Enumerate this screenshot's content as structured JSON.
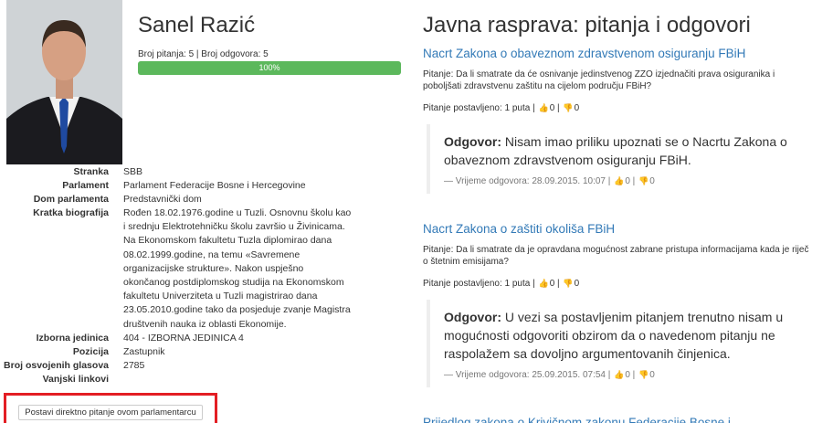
{
  "profile": {
    "name": "Sanel Razić",
    "counts": "Broj pitanja: 5 | Broj odgovora: 5",
    "progress_label": "100%",
    "progress_fraction": 1.0,
    "info": [
      {
        "label": "Stranka",
        "value": "SBB"
      },
      {
        "label": "Parlament",
        "value": "Parlament Federacije Bosne i Hercegovine"
      },
      {
        "label": "Dom parlamenta",
        "value": "Predstavnički dom"
      },
      {
        "label": "Kratka biografija",
        "value": "Rođen 18.02.1976.godine u Tuzli. Osnovnu školu kao i srednju Elektrotehničku školu završio u Živinicama. Na Ekonomskom fakultetu Tuzla diplomirao dana 08.02.1999.godine, na temu «Savremene organizacijske strukture». Nakon uspješno okončanog postdiplomskog studija na Ekonomskom fakultetu Univerziteta u Tuzli magistrirao dana 23.05.2010.godine tako da posjeduje zvanje Magistra društvenih nauka iz oblasti Ekonomije."
      },
      {
        "label": "Izborna jedinica",
        "value": "404 - IZBORNA JEDINICA 4"
      },
      {
        "label": "Pozicija",
        "value": "Zastupnik"
      },
      {
        "label": "Broj osvojenih glasova",
        "value": "2785"
      },
      {
        "label": "Vanjski linkovi",
        "value": ""
      }
    ],
    "direct_question_button": "Postavi direktno pitanje ovom parlamentarcu"
  },
  "discussion": {
    "title": "Javna rasprava: pitanja i odgovori",
    "questions": [
      {
        "law": "Nacrt Zakona o obaveznom zdravstvenom osiguranju FBiH",
        "question": "Pitanje: Da li smatrate da će osnivanje jedinstvenog ZZO izjednačiti prava osiguranika i poboljšati zdravstvenu zaštitu na cijelom području FBiH?",
        "asked": "Pitanje postavljeno: 1 puta",
        "q_likes": "0",
        "q_dislikes": "0",
        "answer_label": "Odgovor:",
        "answer": "Nisam imao priliku upoznati se o Nacrtu Zakona o obaveznom zdravstvenom osiguranju FBiH.",
        "answer_time": "— Vrijeme odgovora: 28.09.2015. 10:07",
        "a_likes": "0",
        "a_dislikes": "0"
      },
      {
        "law": "Nacrt Zakona o zaštiti okoliša FBiH",
        "question": "Pitanje: Da li smatrate da je opravdana mogućnost zabrane pristupa informacijama kada je riječ o štetnim emisijama?",
        "asked": "Pitanje postavljeno: 1 puta",
        "q_likes": "0",
        "q_dislikes": "0",
        "answer_label": "Odgovor:",
        "answer": "U vezi sa postavljenim pitanjem trenutno nisam u mogućnosti odgovoriti obzirom da o navedenom pitanju ne raspolažem sa dovoljno argumentovanih činjenica.",
        "answer_time": "— Vrijeme odgovora: 25.09.2015. 07:54",
        "a_likes": "0",
        "a_dislikes": "0"
      }
    ],
    "third_link_partial": "Prijedlog zakona o Krivičnom zakonu Federacije Bosne i"
  },
  "colors": {
    "link": "#337ab7",
    "progress": "#5cb85c",
    "highlight": "#e31e24"
  },
  "icons": {
    "like": "thumbs-up-icon",
    "dislike": "thumbs-down-icon"
  }
}
